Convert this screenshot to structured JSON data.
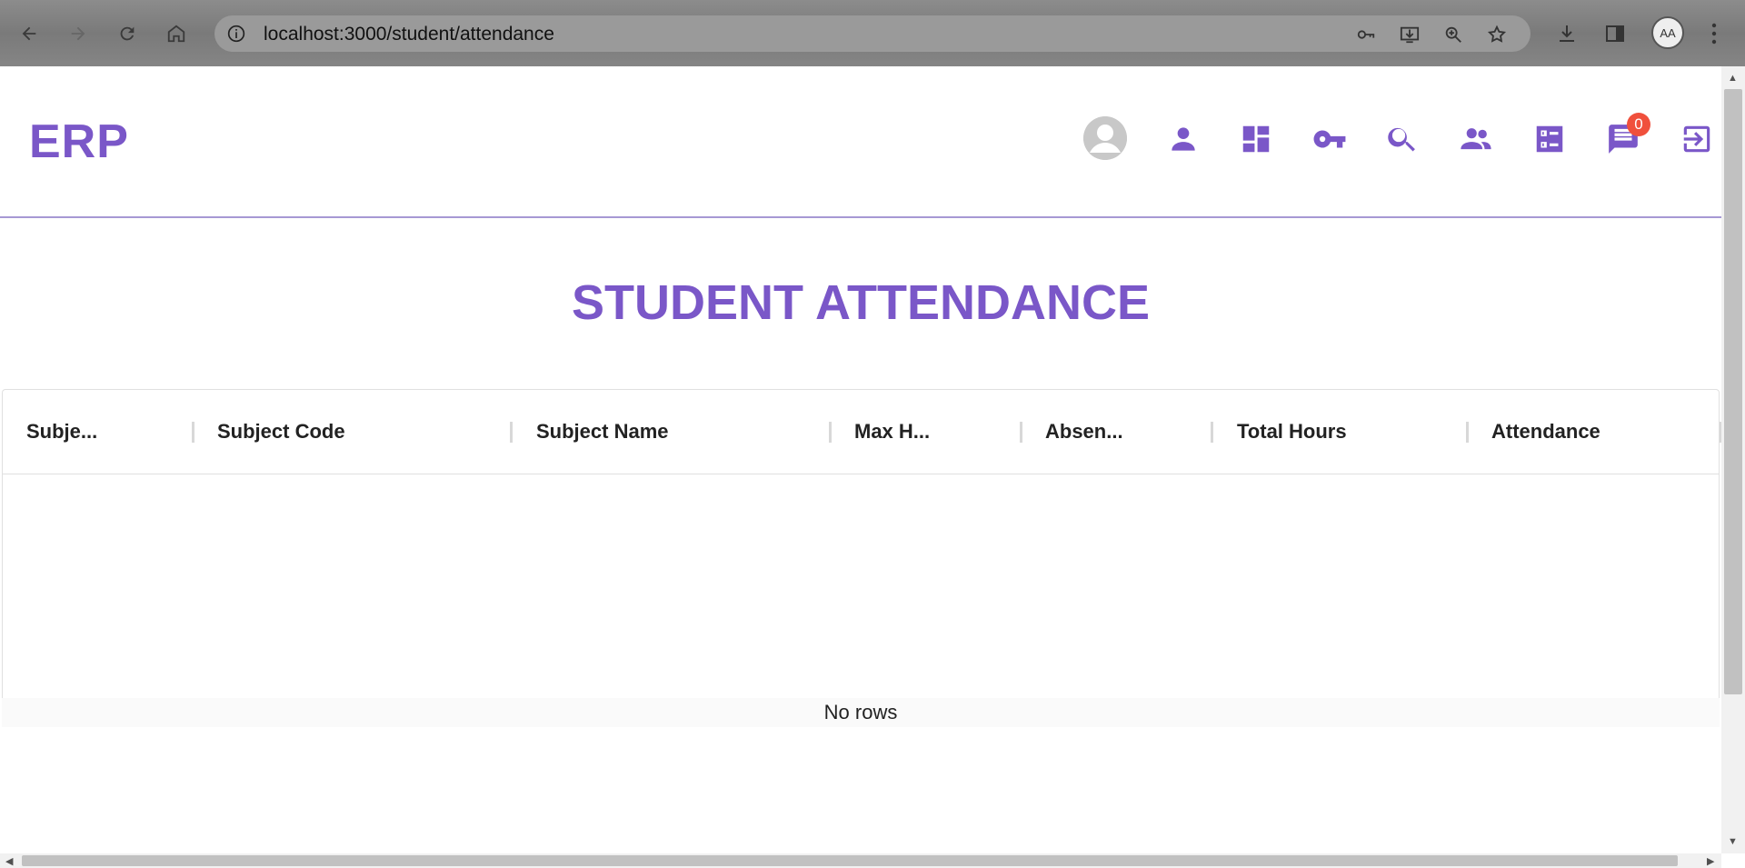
{
  "browser": {
    "url": "localhost:3000/student/attendance",
    "profile_initials": "AA"
  },
  "app": {
    "logo": "ERP",
    "accent": "#7a57c8",
    "notification_count": "0",
    "header_icons": [
      "avatar",
      "person-icon",
      "dashboard-icon",
      "key-icon",
      "search-icon",
      "group-icon",
      "checklist-icon",
      "chat-icon",
      "logout-icon"
    ]
  },
  "page": {
    "title": "STUDENT ATTENDANCE"
  },
  "table": {
    "columns": [
      "Subje...",
      "Subject Code",
      "Subject Name",
      "Max H...",
      "Absen...",
      "Total Hours",
      "Attendance"
    ],
    "empty_text": "No rows"
  }
}
